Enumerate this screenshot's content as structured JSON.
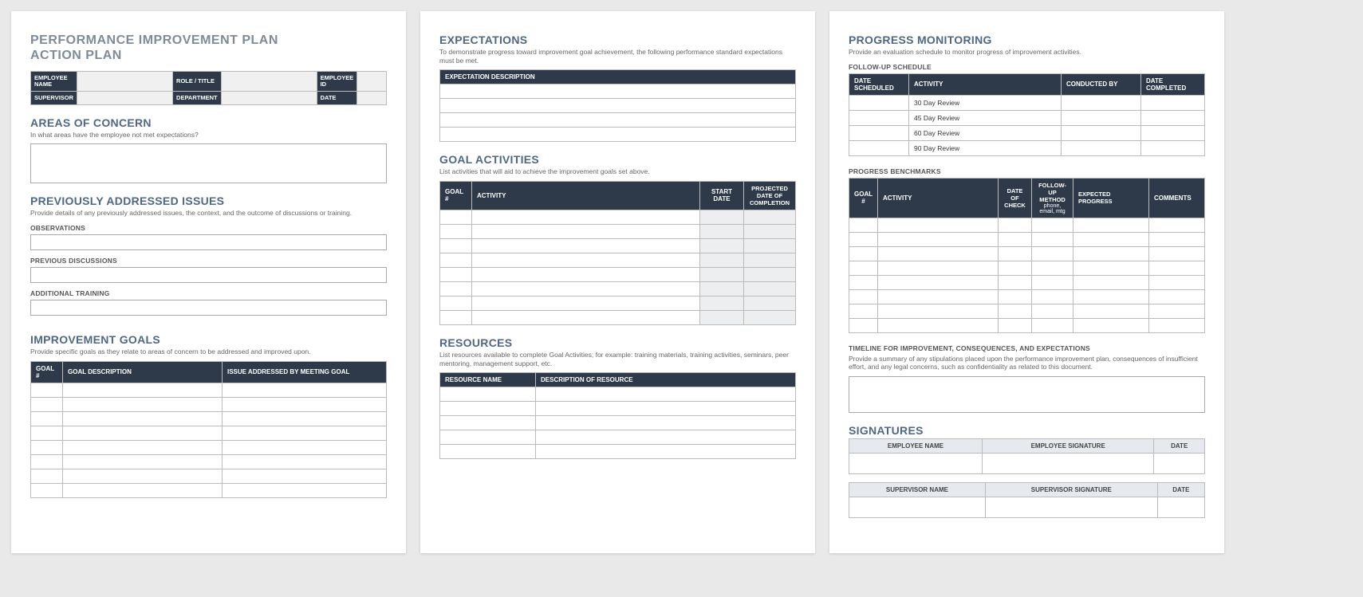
{
  "title1": "PERFORMANCE IMPROVEMENT PLAN",
  "title2": "ACTION PLAN",
  "info": {
    "employee_name": "EMPLOYEE NAME",
    "role_title": "ROLE / TITLE",
    "employee_id": "EMPLOYEE ID",
    "supervisor": "SUPERVISOR",
    "department": "DEPARTMENT",
    "date": "DATE"
  },
  "concern": {
    "heading": "AREAS OF CONCERN",
    "desc": "In what areas have the employee not met expectations?"
  },
  "prev": {
    "heading": "PREVIOUSLY ADDRESSED ISSUES",
    "desc": "Provide details of any previously addressed issues, the context, and the outcome of discussions or training.",
    "observations": "OBSERVATIONS",
    "discussions": "PREVIOUS DISCUSSIONS",
    "training": "ADDITIONAL TRAINING"
  },
  "goals": {
    "heading": "IMPROVEMENT GOALS",
    "desc": "Provide specific goals as they relate to areas of concern to be addressed and improved upon.",
    "cols": [
      "GOAL #",
      "GOAL DESCRIPTION",
      "ISSUE ADDRESSED BY MEETING GOAL"
    ]
  },
  "expect": {
    "heading": "EXPECTATIONS",
    "desc": "To demonstrate progress toward improvement goal achievement, the following performance standard expectations must be met.",
    "col": "EXPECTATION DESCRIPTION"
  },
  "activities": {
    "heading": "GOAL ACTIVITIES",
    "desc": "List activities that will aid to achieve the improvement goals set above.",
    "cols": [
      "GOAL #",
      "ACTIVITY",
      "START DATE",
      "PROJECTED DATE OF COMPLETION"
    ]
  },
  "resources": {
    "heading": "RESOURCES",
    "desc": "List resources available to complete Goal Activities; for example: training materials, training activities, seminars, peer mentoring, management support, etc.",
    "cols": [
      "RESOURCE NAME",
      "DESCRIPTION OF RESOURCE"
    ]
  },
  "monitor": {
    "heading": "PROGRESS MONITORING",
    "desc": "Provide an evaluation schedule to monitor progress of improvement activities.",
    "followup_label": "FOLLOW-UP SCHEDULE",
    "followup_cols": [
      "DATE SCHEDULED",
      "ACTIVITY",
      "CONDUCTED BY",
      "DATE COMPLETED"
    ],
    "followup_rows": [
      "30 Day Review",
      "45 Day Review",
      "60 Day Review",
      "90 Day Review"
    ],
    "bench_label": "PROGRESS BENCHMARKS",
    "bench_cols": {
      "goal": "GOAL #",
      "activity": "ACTIVITY",
      "date": "DATE OF CHECK",
      "method": "FOLLOW-UP METHOD",
      "method_sub": "phone, email, mtg",
      "progress": "EXPECTED PROGRESS",
      "comments": "COMMENTS"
    },
    "timeline_label": "TIMELINE FOR IMPROVEMENT, CONSEQUENCES, AND EXPECTATIONS",
    "timeline_desc": "Provide a summary of any stipulations placed upon the performance improvement plan, consequences of insufficient effort, and any legal concerns, such as confidentiality as related to this document."
  },
  "sig": {
    "heading": "SIGNATURES",
    "emp": [
      "EMPLOYEE NAME",
      "EMPLOYEE SIGNATURE",
      "DATE"
    ],
    "sup": [
      "SUPERVISOR NAME",
      "SUPERVISOR SIGNATURE",
      "DATE"
    ]
  }
}
